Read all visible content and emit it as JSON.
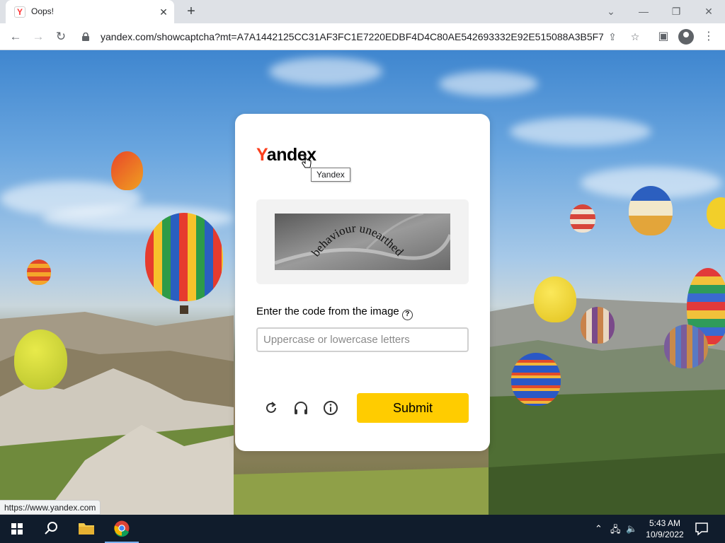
{
  "browser": {
    "tab_title": "Oops!",
    "tab_favicon_letter": "Y",
    "url": "yandex.com/showcaptcha?mt=A7A1442125CC31AF3FC1E7220EDBF4D4C80AE542693332E92E515088A3B5F7FC...",
    "status_url": "https://www.yandex.com"
  },
  "captcha": {
    "logo_first": "Y",
    "logo_rest": "andex",
    "tooltip": "Yandex",
    "captcha_text": "behaviour unearthed",
    "prompt": "Enter the code from the image",
    "input_placeholder": "Uppercase or lowercase letters",
    "input_value": "",
    "submit_label": "Submit",
    "help_glyph": "?",
    "accent_color": "#ffcc00",
    "logo_color": "#fc3f1d"
  },
  "taskbar": {
    "time": "5:43 AM",
    "date": "10/9/2022",
    "icons": [
      "windows-start-icon",
      "search-icon",
      "file-explorer-icon",
      "chrome-icon"
    ]
  }
}
